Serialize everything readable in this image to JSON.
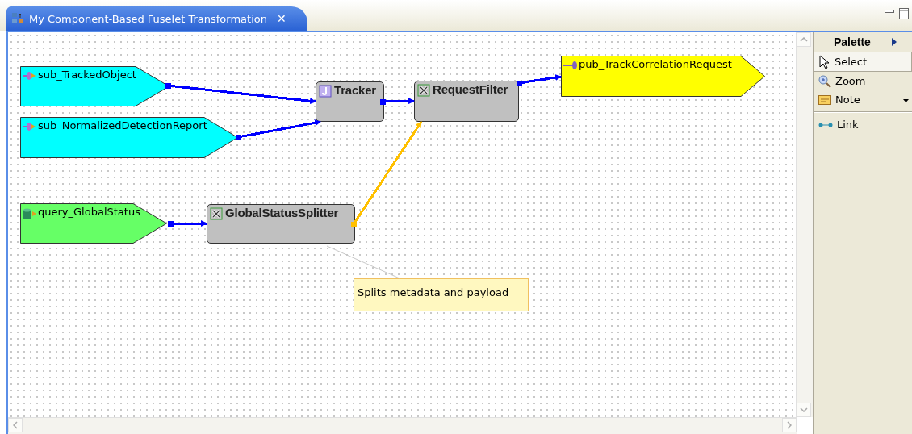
{
  "editor_tab": {
    "title": "My Component-Based Fuselet Transformation",
    "close": "✕",
    "selected": true
  },
  "nodes": [
    {
      "kind": "input",
      "label": "sub_TrackedObject",
      "color": "#00ffff"
    },
    {
      "kind": "input",
      "label": "sub_NormalizedDetectionReport",
      "color": "#00ffff"
    },
    {
      "kind": "query",
      "label": "query_GlobalStatus",
      "color": "#66ff66"
    },
    {
      "kind": "component",
      "label": "Tracker",
      "color": "#c0c0c0"
    },
    {
      "kind": "component",
      "label": "RequestFilter",
      "color": "#c0c0c0"
    },
    {
      "kind": "component",
      "label": "GlobalStatusSplitter",
      "color": "#c0c0c0"
    },
    {
      "kind": "output",
      "label": "pub_TrackCorrelationRequest",
      "color": "#ffff00"
    }
  ],
  "links": [
    {
      "color": "#0000ff"
    },
    {
      "color": "#0000ff"
    },
    {
      "color": "#0000ff"
    },
    {
      "color": "#0000ff"
    },
    {
      "color": "#0000ff"
    },
    {
      "color": "#ffc000"
    }
  ],
  "note": {
    "text": "Splits metadata and payload"
  },
  "palette": {
    "title": "Palette",
    "items": [
      {
        "kind": "select",
        "label": "Select",
        "selected": true
      },
      {
        "kind": "zoom",
        "label": "Zoom",
        "selected": false
      },
      {
        "kind": "note",
        "label": "Note",
        "selected": false,
        "dropdown": true
      },
      {
        "kind": "link",
        "label": "Link",
        "selected": false
      }
    ]
  }
}
